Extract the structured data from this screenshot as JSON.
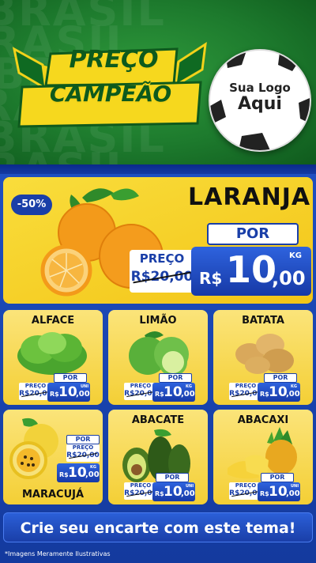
{
  "header": {
    "background_word": "BRASIL",
    "logo_line1": "PREÇO",
    "logo_line2": "CAMPEÃO",
    "placeholder_line1": "Sua Logo",
    "placeholder_line2": "Aqui"
  },
  "featured": {
    "discount": "-50%",
    "name": "LARANJA",
    "por_label": "POR",
    "preco_label": "PREÇO",
    "old_price": "R$20,00",
    "currency": "R$",
    "price_int": "10",
    "price_dec": ",00",
    "unit": "KG"
  },
  "products": [
    {
      "name": "ALFACE",
      "por": "POR",
      "preco": "PREÇO",
      "old": "R$20,00",
      "cur": "R$",
      "int": "10",
      "dec": ",00",
      "unit": "UNI"
    },
    {
      "name": "LIMÃO",
      "por": "POR",
      "preco": "PREÇO",
      "old": "R$20,00",
      "cur": "R$",
      "int": "10",
      "dec": ",00",
      "unit": "KG"
    },
    {
      "name": "BATATA",
      "por": "POR",
      "preco": "PREÇO",
      "old": "R$20,00",
      "cur": "R$",
      "int": "10",
      "dec": ",00",
      "unit": "KG"
    },
    {
      "name": "MARACUJÁ",
      "por": "POR",
      "preco": "PREÇO",
      "old": "R$20,00",
      "cur": "R$",
      "int": "10",
      "dec": ",00",
      "unit": "KG"
    },
    {
      "name": "ABACATE",
      "por": "POR",
      "preco": "PREÇO",
      "old": "R$20,00",
      "cur": "R$",
      "int": "10",
      "dec": ",00",
      "unit": "UNI"
    },
    {
      "name": "ABACAXI",
      "por": "POR",
      "preco": "PREÇO",
      "old": "R$20,00",
      "cur": "R$",
      "int": "10",
      "dec": ",00",
      "unit": "UNI"
    }
  ],
  "cta": "Crie seu encarte com este tema!",
  "disclaimer": "*Imagens Meramente Ilustrativas",
  "colors": {
    "green": "#1d7a2d",
    "yellow": "#f3c517",
    "blue": "#1a3fa8"
  }
}
